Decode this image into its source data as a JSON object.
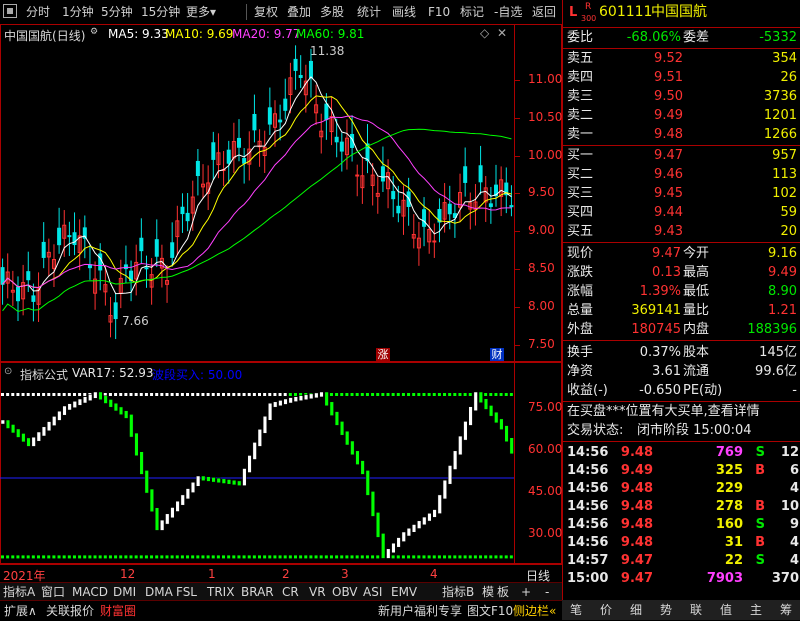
{
  "toolbar": {
    "items": [
      "分时",
      "1分钟",
      "5分钟",
      "15分钟",
      "更多",
      "复权",
      "叠加",
      "多股",
      "统计",
      "画线",
      "F10",
      "标记",
      "-自选",
      "返回"
    ],
    "more_arrow": "▾"
  },
  "chart_header": {
    "stock_name": "中国国航",
    "period": "(日线)",
    "ma5": "MA5: 9.33",
    "ma10": "MA10: 9.69",
    "ma20": "MA20: 9.77",
    "ma60": "MA60: 9.81",
    "high_marker": "11.38",
    "low_marker": "7.66"
  },
  "chart_data": [
    {
      "type": "candlestick",
      "title": "中国国航 (日线)",
      "y_ticks": [
        "11.00",
        "10.50",
        "10.00",
        "9.50",
        "9.00",
        "8.50",
        "8.00",
        "7.50"
      ],
      "ylim": [
        7.3,
        11.5
      ],
      "x_ticks": [
        "2021年",
        "12",
        "1",
        "2",
        "3",
        "4"
      ],
      "series": [
        {
          "name": "MA5",
          "value": 9.33,
          "color": "#ffffff"
        },
        {
          "name": "MA10",
          "value": 9.69,
          "color": "#ffff00"
        },
        {
          "name": "MA20",
          "value": 9.77,
          "color": "#ff40ff"
        },
        {
          "name": "MA60",
          "value": 9.81,
          "color": "#00ff00"
        }
      ],
      "annotations": [
        "11.38",
        "7.66",
        "涨",
        "财"
      ]
    },
    {
      "type": "bar",
      "title": "指标公式",
      "series": [
        {
          "name": "VAR17",
          "value": 52.93
        }
      ],
      "y_ticks": [
        "75.00",
        "60.00",
        "45.00",
        "30.00"
      ],
      "ylim": [
        20,
        85
      ]
    }
  ],
  "indicator_header": {
    "name": "指标公式",
    "var": "VAR17: 52.93",
    "band": "波段买入: 50.00"
  },
  "x_axis": {
    "labels": [
      "2021年",
      "12",
      "1",
      "2",
      "3",
      "4"
    ],
    "period_label": "日线"
  },
  "markers": {
    "zhang": "涨",
    "cai": "财"
  },
  "quote": {
    "letters": {
      "L": "L",
      "R": "R",
      "num": "300"
    },
    "code": "601111",
    "name": "中国国航",
    "weibi_label": "委比",
    "weibi": "-68.06%",
    "weicha_label": "委差",
    "weicha": "-5332",
    "sells": [
      {
        "label": "卖五",
        "price": "9.52",
        "vol": "354"
      },
      {
        "label": "卖四",
        "price": "9.51",
        "vol": "26"
      },
      {
        "label": "卖三",
        "price": "9.50",
        "vol": "3736"
      },
      {
        "label": "卖二",
        "price": "9.49",
        "vol": "1201"
      },
      {
        "label": "卖一",
        "price": "9.48",
        "vol": "1266"
      }
    ],
    "buys": [
      {
        "label": "买一",
        "price": "9.47",
        "vol": "957"
      },
      {
        "label": "买二",
        "price": "9.46",
        "vol": "113"
      },
      {
        "label": "买三",
        "price": "9.45",
        "vol": "102"
      },
      {
        "label": "买四",
        "price": "9.44",
        "vol": "59"
      },
      {
        "label": "买五",
        "price": "9.43",
        "vol": "20"
      }
    ],
    "stats": [
      {
        "l1": "现价",
        "v1": "9.47",
        "l2": "今开",
        "v2": "9.16"
      },
      {
        "l1": "涨跌",
        "v1": "0.13",
        "l2": "最高",
        "v2": "9.49"
      },
      {
        "l1": "涨幅",
        "v1": "1.39%",
        "l2": "最低",
        "v2": "8.90"
      },
      {
        "l1": "总量",
        "v1": "369141",
        "l2": "量比",
        "v2": "1.21"
      },
      {
        "l1": "外盘",
        "v1": "180745",
        "l2": "内盘",
        "v2": "188396"
      }
    ],
    "fund": [
      {
        "l1": "换手",
        "v1": "0.37%",
        "l2": "股本",
        "v2": "145亿"
      },
      {
        "l1": "净资",
        "v1": "3.61",
        "l2": "流通",
        "v2": "99.6亿"
      },
      {
        "l1": "收益(-)",
        "v1": "-0.650",
        "l2": "PE(动)",
        "v2": "-"
      }
    ],
    "notice": "在买盘***位置有大买单,查看详情",
    "state_label": "交易状态:",
    "state": "闭市阶段 15:00:04",
    "ticks": [
      {
        "t": "14:56",
        "p": "9.48",
        "v": "769",
        "bs": "S",
        "n": "12"
      },
      {
        "t": "14:56",
        "p": "9.49",
        "v": "325",
        "bs": "B",
        "n": "6"
      },
      {
        "t": "14:56",
        "p": "9.48",
        "v": "229",
        "bs": "",
        "n": "4"
      },
      {
        "t": "14:56",
        "p": "9.48",
        "v": "278",
        "bs": "B",
        "n": "10"
      },
      {
        "t": "14:56",
        "p": "9.48",
        "v": "160",
        "bs": "S",
        "n": "9"
      },
      {
        "t": "14:56",
        "p": "9.48",
        "v": "31",
        "bs": "B",
        "n": "4"
      },
      {
        "t": "14:57",
        "p": "9.47",
        "v": "22",
        "bs": "S",
        "n": "4"
      },
      {
        "t": "15:00",
        "p": "9.47",
        "v": "7903",
        "bs": "",
        "n": "370"
      }
    ]
  },
  "indicator_tabs": [
    "指标A",
    "窗口",
    "MACD",
    "DMI",
    "DMA",
    "FSL",
    "TRIX",
    "BRAR",
    "CR",
    "VR",
    "OBV",
    "ASI",
    "EMV",
    "指标B",
    "模",
    "板",
    "+",
    "-"
  ],
  "bottom_bar": {
    "expand": "扩展∧",
    "associate": "关联报价",
    "treasure": "财富圈",
    "welfare": "新用户福利专享",
    "f10": "图文F10",
    "sidebar": "侧边栏",
    "sidebar_arrow": "«",
    "right_tabs": [
      "笔",
      "价",
      "细",
      "势",
      "联",
      "值",
      "主",
      "筹"
    ]
  },
  "colors": {
    "up": "#ff3232",
    "down": "#00e6e6",
    "ind_up": "#ffffff",
    "ind_down": "#00ff00",
    "frame": "#aa0000"
  }
}
